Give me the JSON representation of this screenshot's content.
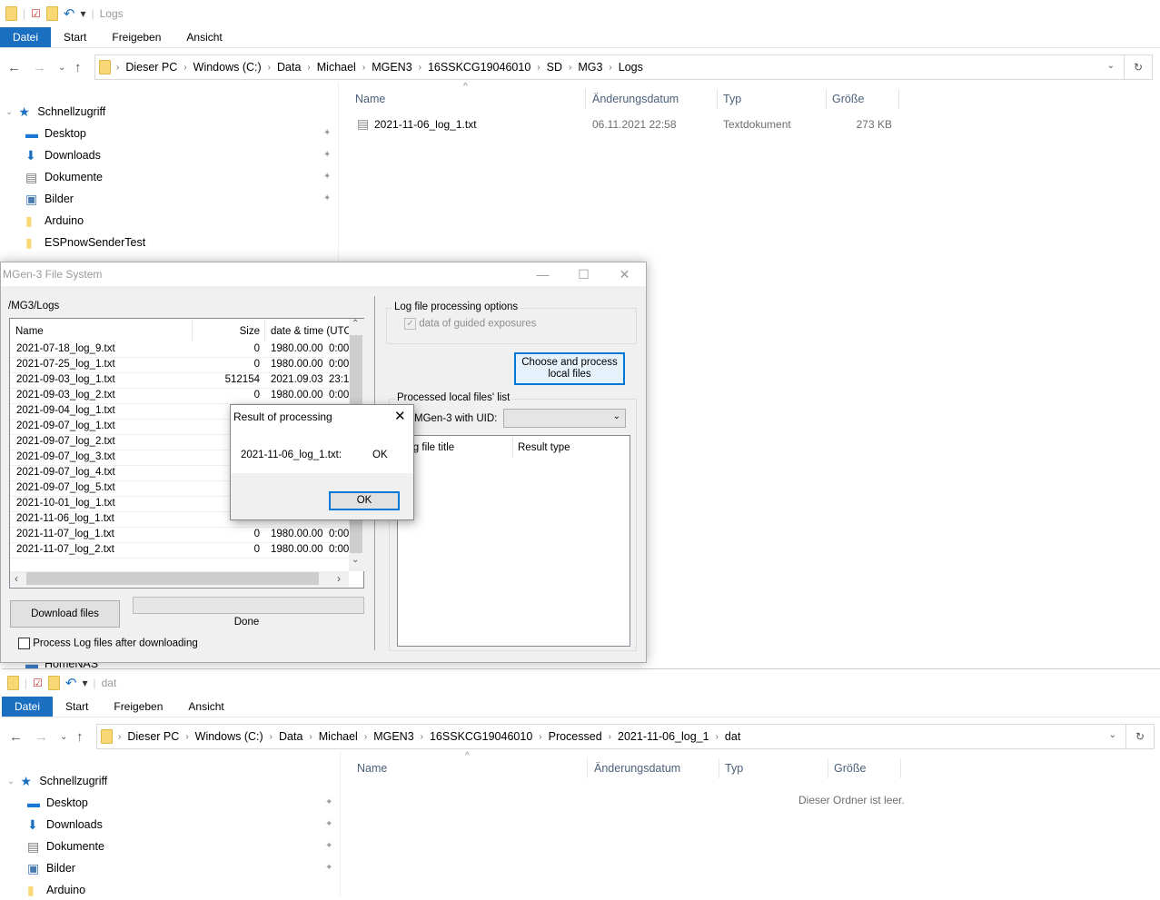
{
  "top_explorer": {
    "title": "Logs",
    "ribbon_tabs": [
      "Datei",
      "Start",
      "Freigeben",
      "Ansicht"
    ],
    "breadcrumb": [
      "Dieser PC",
      "Windows (C:)",
      "Data",
      "Michael",
      "MGEN3",
      "16SSKCG19046010",
      "SD",
      "MG3",
      "Logs"
    ],
    "columns": [
      "Name",
      "Änderungsdatum",
      "Typ",
      "Größe"
    ],
    "files": [
      {
        "name": "2021-11-06_log_1.txt",
        "date": "06.11.2021 22:58",
        "type": "Textdokument",
        "size": "273 KB"
      }
    ],
    "sidebar": [
      {
        "label": "Schnellzugriff",
        "icon": "star-icon"
      },
      {
        "label": "Desktop",
        "icon": "desktop-icon",
        "pinned": true
      },
      {
        "label": "Downloads",
        "icon": "download-icon",
        "pinned": true
      },
      {
        "label": "Dokumente",
        "icon": "document-icon",
        "pinned": true
      },
      {
        "label": "Bilder",
        "icon": "pictures-icon",
        "pinned": true
      },
      {
        "label": "Arduino",
        "icon": "folder-icon"
      },
      {
        "label": "ESPnowSenderTest",
        "icon": "folder-icon"
      },
      {
        "label": "HomeNAS",
        "icon": "nas-icon"
      }
    ]
  },
  "dialog": {
    "title": "MGen-3 File System",
    "path": "/MG3/Logs",
    "list_columns": [
      "Name",
      "Size",
      "date & time (UTC)"
    ],
    "files": [
      {
        "name": "2021-07-18_log_9.txt",
        "size": "0",
        "date": "1980.00.00  0:00"
      },
      {
        "name": "2021-07-25_log_1.txt",
        "size": "0",
        "date": "1980.00.00  0:00"
      },
      {
        "name": "2021-09-03_log_1.txt",
        "size": "512154",
        "date": "2021.09.03  23:1"
      },
      {
        "name": "2021-09-03_log_2.txt",
        "size": "0",
        "date": "1980.00.00  0:00"
      },
      {
        "name": "2021-09-04_log_1.txt",
        "size": "",
        "date": ""
      },
      {
        "name": "2021-09-07_log_1.txt",
        "size": "",
        "date": ""
      },
      {
        "name": "2021-09-07_log_2.txt",
        "size": "",
        "date": ""
      },
      {
        "name": "2021-09-07_log_3.txt",
        "size": "",
        "date": ""
      },
      {
        "name": "2021-09-07_log_4.txt",
        "size": "",
        "date": ""
      },
      {
        "name": "2021-09-07_log_5.txt",
        "size": "",
        "date": ""
      },
      {
        "name": "2021-10-01_log_1.txt",
        "size": "",
        "date": ""
      },
      {
        "name": "2021-11-06_log_1.txt",
        "size": "",
        "date": ""
      },
      {
        "name": "2021-11-07_log_1.txt",
        "size": "0",
        "date": "1980.00.00  0:00"
      },
      {
        "name": "2021-11-07_log_2.txt",
        "size": "0",
        "date": "1980.00.00  0:00"
      }
    ],
    "download_button": "Download files",
    "progress": 0,
    "status": "Done",
    "process_after_download": {
      "label": "Process Log files after downloading",
      "checked": false
    },
    "options_group": "Log file processing options",
    "guided_exposures": {
      "label": "data of guided exposures",
      "checked": true,
      "disabled": true
    },
    "choose_button": "Choose and process local files",
    "processed_group": "Processed local files' list",
    "uid_label": "MGen-3 with UID:",
    "uid_value": "",
    "processed_columns": [
      "Log file title",
      "Result type"
    ]
  },
  "message_box": {
    "title": "Result of processing",
    "file": "2021-11-06_log_1.txt:",
    "result": "OK",
    "ok_button": "OK"
  },
  "bottom_explorer": {
    "title": "dat",
    "ribbon_tabs": [
      "Datei",
      "Start",
      "Freigeben",
      "Ansicht"
    ],
    "breadcrumb": [
      "Dieser PC",
      "Windows (C:)",
      "Data",
      "Michael",
      "MGEN3",
      "16SSKCG19046010",
      "Processed",
      "2021-11-06_log_1",
      "dat"
    ],
    "columns": [
      "Name",
      "Änderungsdatum",
      "Typ",
      "Größe"
    ],
    "empty_text": "Dieser Ordner ist leer.",
    "sidebar": [
      {
        "label": "Schnellzugriff",
        "icon": "star-icon"
      },
      {
        "label": "Desktop",
        "icon": "desktop-icon",
        "pinned": true
      },
      {
        "label": "Downloads",
        "icon": "download-icon",
        "pinned": true
      },
      {
        "label": "Dokumente",
        "icon": "document-icon",
        "pinned": true
      },
      {
        "label": "Bilder",
        "icon": "pictures-icon",
        "pinned": true
      },
      {
        "label": "Arduino",
        "icon": "folder-icon"
      }
    ]
  },
  "colors": {
    "accent": "#1a6fc1",
    "focus_border": "#0078d7"
  }
}
